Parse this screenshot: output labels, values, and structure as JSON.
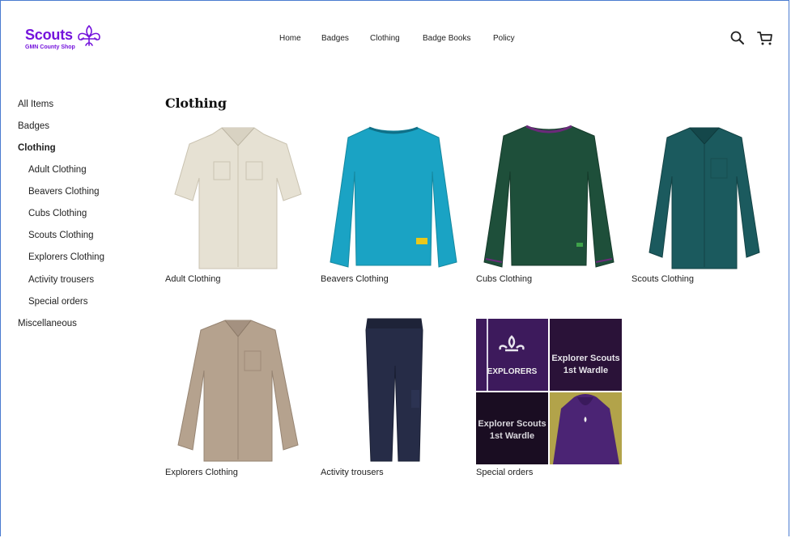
{
  "brand": {
    "name": "Scouts",
    "subtitle": "GMN County Shop",
    "color": "#7413dc"
  },
  "nav": {
    "items": [
      "Home",
      "Badges",
      "Clothing",
      "Badge Books",
      "Policy"
    ]
  },
  "header_icons": [
    "search-icon",
    "cart-icon"
  ],
  "sidebar": {
    "items": [
      {
        "label": "All Items",
        "level": 0,
        "active": false
      },
      {
        "label": "Badges",
        "level": 0,
        "active": false
      },
      {
        "label": "Clothing",
        "level": 0,
        "active": true
      },
      {
        "label": "Adult Clothing",
        "level": 1,
        "active": false
      },
      {
        "label": "Beavers Clothing",
        "level": 1,
        "active": false
      },
      {
        "label": "Cubs Clothing",
        "level": 1,
        "active": false
      },
      {
        "label": "Scouts Clothing",
        "level": 1,
        "active": false
      },
      {
        "label": "Explorers Clothing",
        "level": 1,
        "active": false
      },
      {
        "label": "Activity trousers",
        "level": 1,
        "active": false
      },
      {
        "label": "Special orders",
        "level": 1,
        "active": false
      },
      {
        "label": "Miscellaneous",
        "level": 0,
        "active": false
      }
    ]
  },
  "main": {
    "title": "Clothing",
    "products": [
      {
        "label": "Adult Clothing",
        "image": "beige-short-sleeve-shirt",
        "color": "#e6e1d3"
      },
      {
        "label": "Beavers Clothing",
        "image": "turquoise-sweatshirt",
        "color": "#1aa3c4"
      },
      {
        "label": "Cubs Clothing",
        "image": "dark-green-jumper",
        "color": "#1e4f3a"
      },
      {
        "label": "Scouts Clothing",
        "image": "teal-long-sleeve-shirt",
        "color": "#1b5a5e"
      },
      {
        "label": "Explorers Clothing",
        "image": "beige-long-sleeve-shirt",
        "color": "#b5a28e"
      },
      {
        "label": "Activity trousers",
        "image": "navy-trousers",
        "color": "#262c47"
      },
      {
        "label": "Special orders",
        "image": "purple-hoodie-collage",
        "color": "#3d1a5c"
      }
    ],
    "special_texts": {
      "explorers": "EXPLORERS",
      "scouts_line1": "Explorer Scouts",
      "scouts_line2": "1st Wardle"
    }
  }
}
